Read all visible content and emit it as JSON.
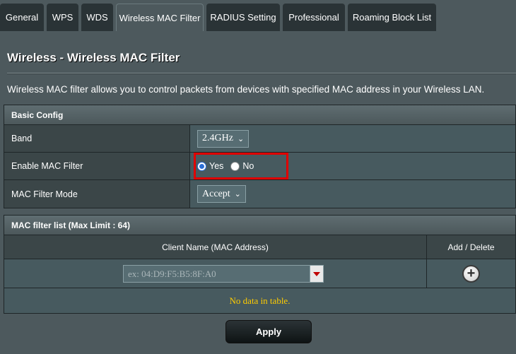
{
  "tabs": [
    {
      "label": "General"
    },
    {
      "label": "WPS"
    },
    {
      "label": "WDS"
    },
    {
      "label": "Wireless MAC Filter",
      "active": true
    },
    {
      "label": "RADIUS Setting"
    },
    {
      "label": "Professional"
    },
    {
      "label": "Roaming Block List"
    }
  ],
  "page": {
    "title": "Wireless - Wireless MAC Filter",
    "description": "Wireless MAC filter allows you to control packets from devices with specified MAC address in your Wireless LAN."
  },
  "basic_config": {
    "header": "Basic Config",
    "band": {
      "label": "Band",
      "value": "2.4GHz"
    },
    "enable_mac_filter": {
      "label": "Enable MAC Filter",
      "yes_label": "Yes",
      "no_label": "No",
      "selected": "Yes"
    },
    "mac_filter_mode": {
      "label": "MAC Filter Mode",
      "value": "Accept"
    }
  },
  "mac_list": {
    "header": "MAC filter list (Max Limit : 64)",
    "col_client": "Client Name (MAC Address)",
    "col_action": "Add / Delete",
    "input_placeholder": "ex: 04:D9:F5:B5:8F:A0",
    "empty_text": "No data in table."
  },
  "apply_label": "Apply",
  "colors": {
    "background": "#4d595d",
    "highlight_box": "#e00000",
    "empty_text": "#ffcc00",
    "radio_selected": "#2b6fd6"
  }
}
